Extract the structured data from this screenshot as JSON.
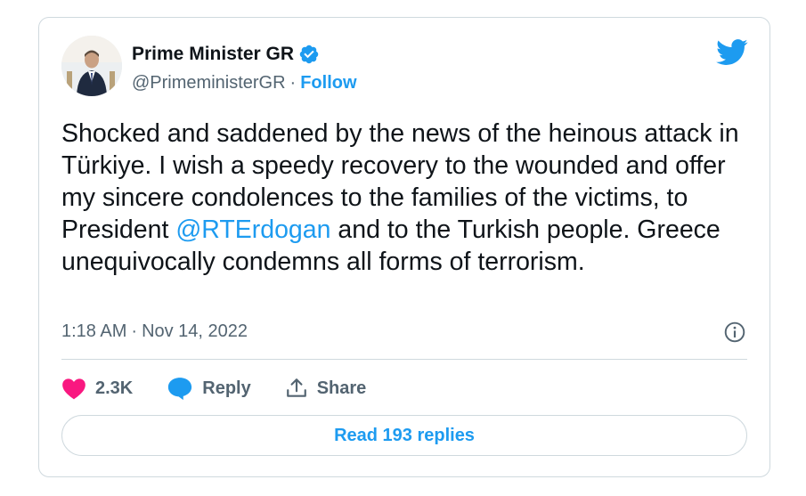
{
  "author": {
    "display_name": "Prime Minister GR",
    "handle": "@PrimeministerGR",
    "separator": "·",
    "follow_label": "Follow"
  },
  "tweet": {
    "text_before_mention": "Shocked and saddened by the news of the heinous attack in Türkiye. I wish a speedy recovery to the wounded and offer my sincere condolences to the families of the victims, to President ",
    "mention": "@RTErdogan",
    "text_after_mention": " and to the Turkish people. Greece unequivocally condemns all forms of terrorism."
  },
  "meta": {
    "time": "1:18 AM",
    "separator": "·",
    "date": "Nov 14, 2022"
  },
  "actions": {
    "likes_count": "2.3K",
    "reply_label": "Reply",
    "share_label": "Share"
  },
  "read_replies_label": "Read 193 replies",
  "colors": {
    "accent": "#1d9bf0",
    "like": "#f91880",
    "secondary_text": "#536471",
    "border": "#cfd9de"
  },
  "icons": [
    "verified-badge-icon",
    "twitter-bird-icon",
    "info-icon",
    "heart-icon",
    "reply-bubble-icon",
    "share-icon"
  ]
}
